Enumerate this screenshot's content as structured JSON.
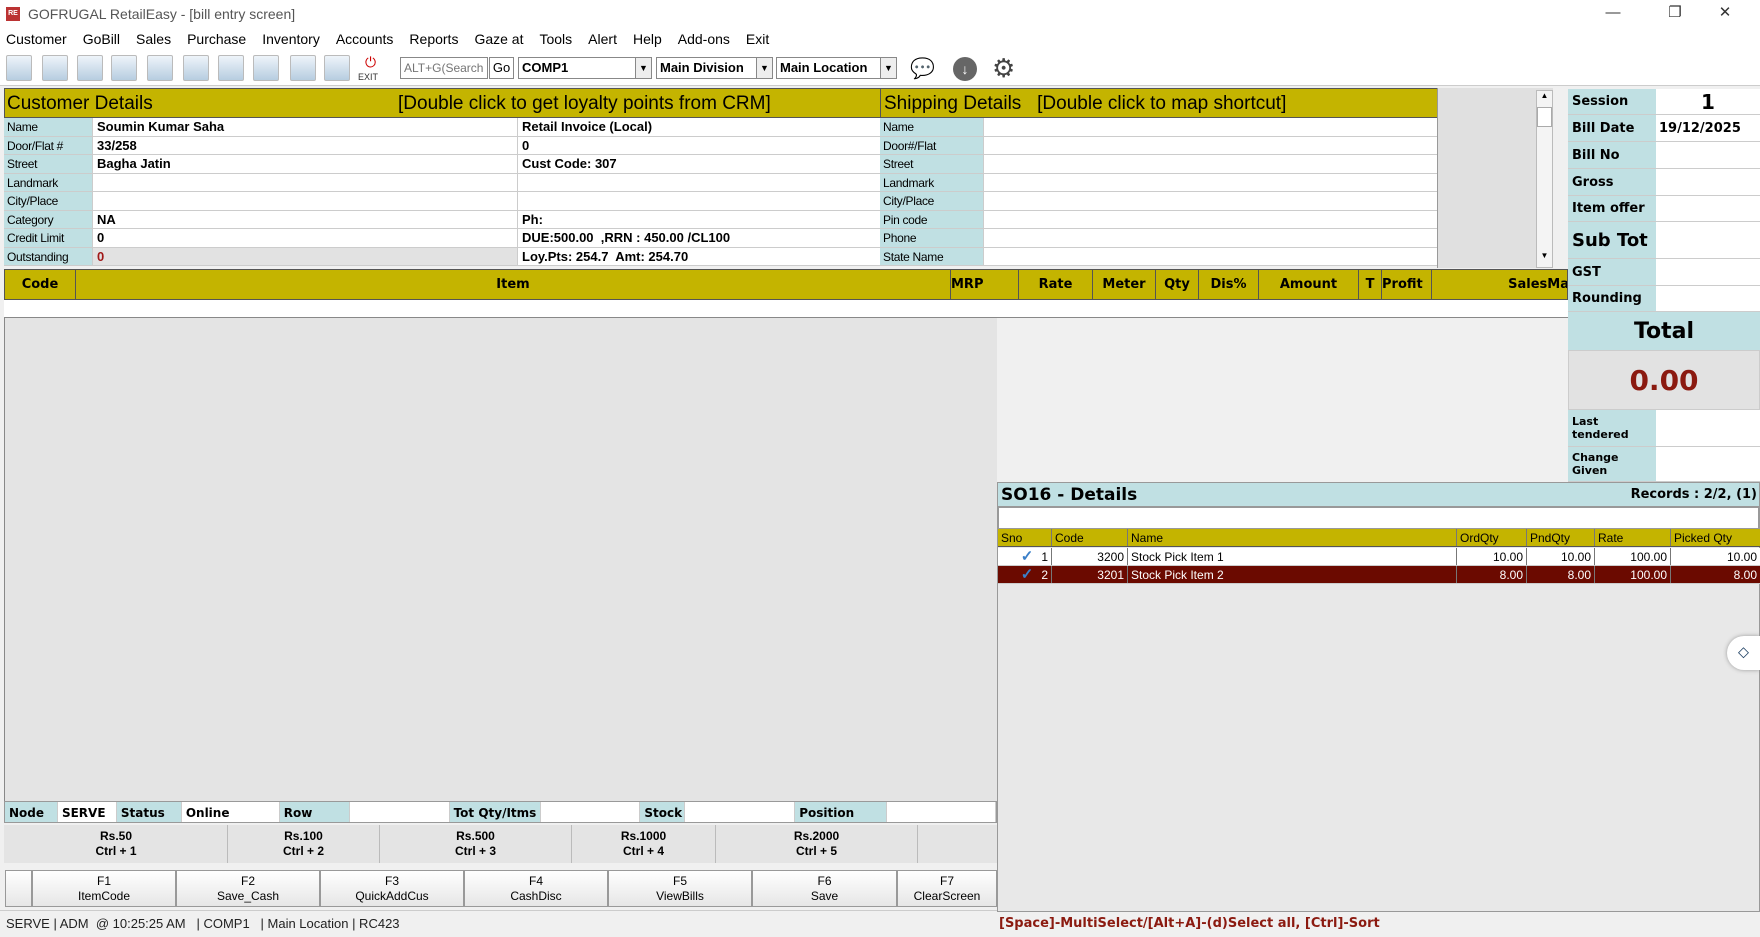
{
  "window": {
    "title": "GOFRUGAL RetailEasy - [bill entry screen]",
    "minimize": "—",
    "restore": "❐",
    "close": "✕"
  },
  "menu": [
    "Customer",
    "GoBill",
    "Sales",
    "Purchase",
    "Inventory",
    "Accounts",
    "Reports",
    "Gaze at",
    "Tools",
    "Alert",
    "Help",
    "Add-ons",
    "Exit"
  ],
  "toolbar": {
    "exit_label": "EXIT",
    "search_placeholder": "ALT+G(Search",
    "go": "Go",
    "company": "COMP1",
    "division": "Main Division",
    "location": "Main Location"
  },
  "customer": {
    "title": "Customer Details",
    "hint": "[Double click to get loyalty points from CRM]",
    "rows": [
      [
        "Name",
        "Soumin Kumar Saha",
        "Retail Invoice (Local)"
      ],
      [
        "Door/Flat #",
        "33/258",
        "0"
      ],
      [
        "Street",
        "Bagha Jatin",
        "Cust Code: 307"
      ],
      [
        "Landmark",
        "",
        ""
      ],
      [
        "City/Place",
        "",
        ""
      ],
      [
        "Category",
        "NA",
        "Ph:"
      ],
      [
        "Credit Limit",
        "0",
        "DUE:500.00  ,RRN : 450.00 /CL100"
      ],
      [
        "Outstanding",
        "0",
        "Loy.Pts: 254.7  Amt: 254.70"
      ]
    ]
  },
  "shipping": {
    "title": "Shipping Details   [Double click to map shortcut]",
    "labels": [
      "Name",
      "Door#/Flat",
      "Street",
      "Landmark",
      "City/Place",
      "Pin code",
      "Phone",
      "State Name"
    ]
  },
  "grid_headers": [
    "Code",
    "Item",
    "MRP",
    "Rate",
    "Meter",
    "Qty",
    "Dis%",
    "Amount",
    "T",
    "Profit",
    "SalesMa"
  ],
  "summary": {
    "session_label": "Session",
    "session": "1",
    "bill_date_label": "Bill Date",
    "bill_date": "19/12/2025",
    "bill_no_label": "Bill No",
    "gross_label": "Gross",
    "item_offer_label": "Item offer",
    "sub_tot_label": "Sub Tot",
    "gst_label": "GST",
    "rounding_label": "Rounding",
    "total_label": "Total",
    "total": "0.00",
    "last_tendered_label": "Last tendered",
    "change_given_label": "Change Given"
  },
  "so": {
    "title": "SO16 - Details",
    "records": "Records : 2/2, (1)",
    "search_value": "",
    "headers": [
      "Sno",
      "Code",
      "Name",
      "OrdQty",
      "PndQty",
      "Rate",
      "Picked Qty"
    ],
    "rows": [
      {
        "sno": "1",
        "code": "3200",
        "name": "Stock Pick Item 1",
        "ord": "10.00",
        "pnd": "10.00",
        "rate": "100.00",
        "picked": "10.00",
        "checked": true,
        "selected": false
      },
      {
        "sno": "2",
        "code": "3201",
        "name": "Stock Pick Item 2",
        "ord": "8.00",
        "pnd": "8.00",
        "rate": "100.00",
        "picked": "8.00",
        "checked": true,
        "selected": true
      }
    ],
    "hint": "[Space]-MultiSelect/[Alt+A]-(d)Select all, [Ctrl]-Sort"
  },
  "status_row": {
    "node_label": "Node",
    "node": "SERVE",
    "status_label": "Status",
    "status": "Online",
    "row_label": "Row",
    "row": "",
    "tot_label": "Tot Qty/Itms",
    "tot": "",
    "stock_label": "Stock",
    "stock": "",
    "position_label": "Position",
    "position": ""
  },
  "denominations": [
    [
      "Rs.50",
      "Ctrl + 1"
    ],
    [
      "Rs.100",
      "Ctrl + 2"
    ],
    [
      "Rs.500",
      "Ctrl + 3"
    ],
    [
      "Rs.1000",
      "Ctrl + 4"
    ],
    [
      "Rs.2000",
      "Ctrl + 5"
    ]
  ],
  "fkeys": [
    [
      "F1",
      "ItemCode"
    ],
    [
      "F2",
      "Save_Cash"
    ],
    [
      "F3",
      "QuickAddCus"
    ],
    [
      "F4",
      "CashDisc"
    ],
    [
      "F5",
      "ViewBills"
    ],
    [
      "F6",
      "Save"
    ],
    [
      "F7",
      "ClearScreen"
    ]
  ],
  "statusbar": "SERVE | ADM  @ 10:25:25 AM   | COMP1   | Main Location | RC423",
  "colors": {
    "header_yellow": "#c4b400",
    "label_cyan": "#c0e0e3",
    "selected_row": "#6b0a00",
    "total_red": "#8b1a10"
  }
}
